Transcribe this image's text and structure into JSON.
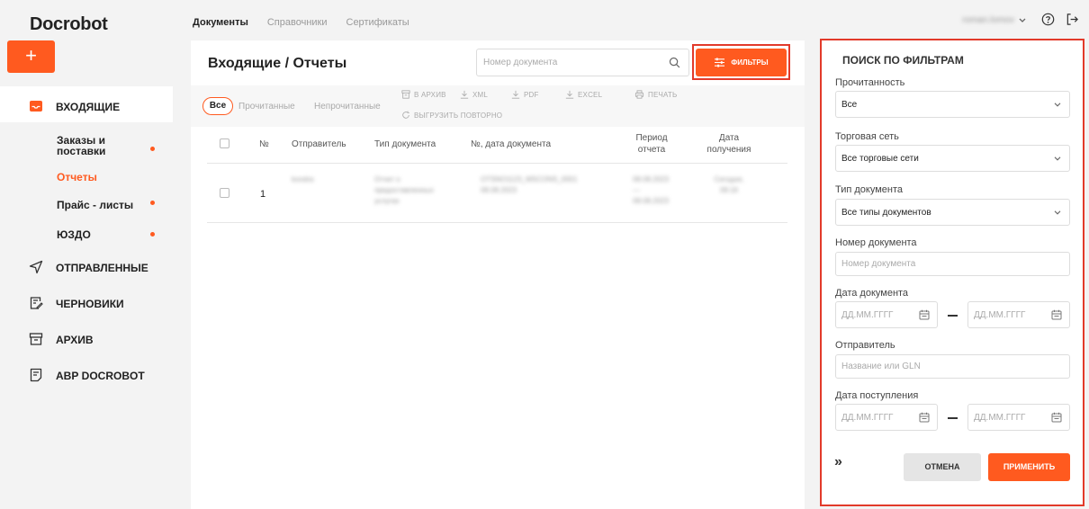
{
  "brand": {
    "logo": "Docrobot",
    "accent": "#ff5a1f",
    "highlight": "#e23a2a"
  },
  "topnav": {
    "items": [
      "Документы",
      "Справочники",
      "Сертификаты"
    ],
    "active": "Документы"
  },
  "user": {
    "name": "roman.lomov"
  },
  "sidebar": {
    "add_label": "+",
    "items": [
      {
        "label": "ВХОДЯЩИЕ",
        "icon": "inbox-icon"
      },
      {
        "label": "ОТПРАВЛЕННЫЕ",
        "icon": "send-icon"
      },
      {
        "label": "ЧЕРНОВИКИ",
        "icon": "draft-icon"
      },
      {
        "label": "АРХИВ",
        "icon": "archive-icon"
      },
      {
        "label": "АВР DOCROBOT",
        "icon": "document-icon"
      }
    ],
    "subitems": [
      {
        "label": "Заказы и поставки",
        "line1": "Заказы и",
        "line2": "поставки",
        "unread": true
      },
      {
        "label": "Отчеты",
        "active": true
      },
      {
        "label": "Прайс - листы",
        "unread": true
      },
      {
        "label": "ЮЗДО",
        "unread": true
      }
    ]
  },
  "main": {
    "title": "Входящие / Отчеты",
    "search_placeholder": "Номер документа",
    "filter_button": "ФИЛЬТРЫ",
    "chips": [
      "Все",
      "Прочитанные",
      "Непрочитанные"
    ],
    "actions": {
      "archive": "В АРХИВ",
      "xml": "XML",
      "pdf": "PDF",
      "excel": "EXCEL",
      "print": "ПЕЧАТЬ",
      "reupload": "ВЫГРУЗИТЬ ПОВТОРНО"
    },
    "columns": {
      "num": "№",
      "sender": "Отправитель",
      "doctype": "Тип документа",
      "docno": "№, дата документа",
      "period_l1": "Период",
      "period_l2": "отчета",
      "recv_l1": "Дата",
      "recv_l2": "получения"
    },
    "rows": [
      {
        "num": "1",
        "sender": "kondra",
        "doctype_l1": "Отчет о",
        "doctype_l2": "предоставленных",
        "doctype_l3": "услугах",
        "docno_l1": "OTSNO1123_MSCONS_0001",
        "docno_l2": "08.08.2023",
        "period_from": "08.08.2023",
        "period_sep": "—",
        "period_to": "08.08.2023",
        "recv_l1": "Сегодня,",
        "recv_l2": "09:16"
      }
    ]
  },
  "filters": {
    "title": "ПОИСК ПО ФИЛЬТРАМ",
    "read_label": "Прочитанность",
    "read_value": "Все",
    "chain_label": "Торговая сеть",
    "chain_value": "Все торговые сети",
    "doctype_label": "Тип документа",
    "doctype_value": "Все типы документов",
    "docno_label": "Номер документа",
    "docno_placeholder": "Номер документа",
    "docdate_label": "Дата документа",
    "date_placeholder": "ДД.ММ.ГГГГ",
    "sender_label": "Отправитель",
    "sender_placeholder": "Название или GLN",
    "recvdate_label": "Дата поступления",
    "collapse": "»",
    "cancel": "ОТМЕНА",
    "apply": "ПРИМЕНИТЬ"
  }
}
